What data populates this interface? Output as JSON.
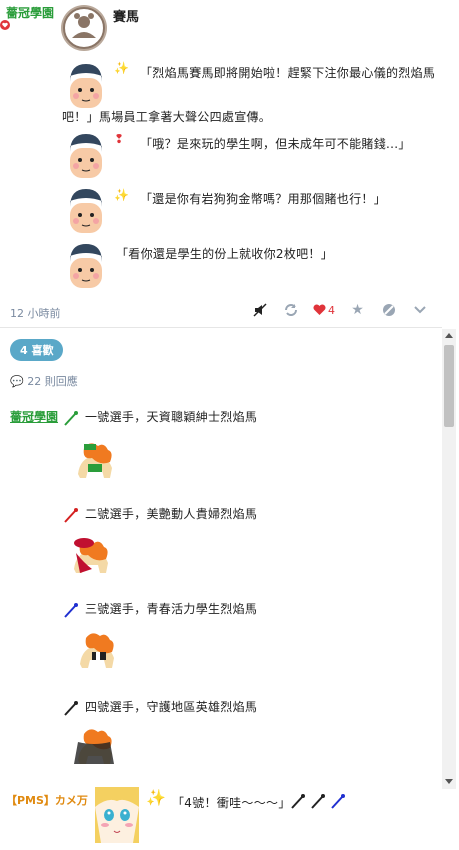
{
  "post": {
    "author": "薔冠學園",
    "title": "賽馬",
    "lines": [
      "「烈焰馬賽馬即將開始啦！趕緊下注你最心儀的烈焰馬",
      "吧！」馬場員工拿著大聲公四處宣傳。",
      "「哦？是來玩的學生啊，但未成年可不能賭錢...」",
      "「還是你有岩狗狗金幣嗎？用那個賭也行！」",
      "「看你還是學生的份上就收你2枚吧！」"
    ],
    "time": "12 小時前",
    "like_count": "4"
  },
  "likes_pill": "4 喜歡",
  "replies": "22 則回應",
  "reply": {
    "author": "薔冠學園",
    "entries": [
      {
        "text": "一號選手，天資聰穎紳士烈焰馬",
        "color": "#2a9d3a"
      },
      {
        "text": "二號選手，美艷動人貴婦烈焰馬",
        "color": "#d42020"
      },
      {
        "text": "三號選手，青春活力學生烈焰馬",
        "color": "#2030d0"
      },
      {
        "text": "四號選手，守護地區英雄烈焰馬",
        "color": "#222222"
      }
    ]
  },
  "bottom": {
    "author": "【PMS】カメ万",
    "text": "「4號！衝哇～～～」"
  },
  "icons": {
    "mute": "mute-icon",
    "share": "repost-icon",
    "heart": "heart-icon",
    "star": "star-icon",
    "block": "block-icon",
    "more": "chevron-down-icon"
  }
}
